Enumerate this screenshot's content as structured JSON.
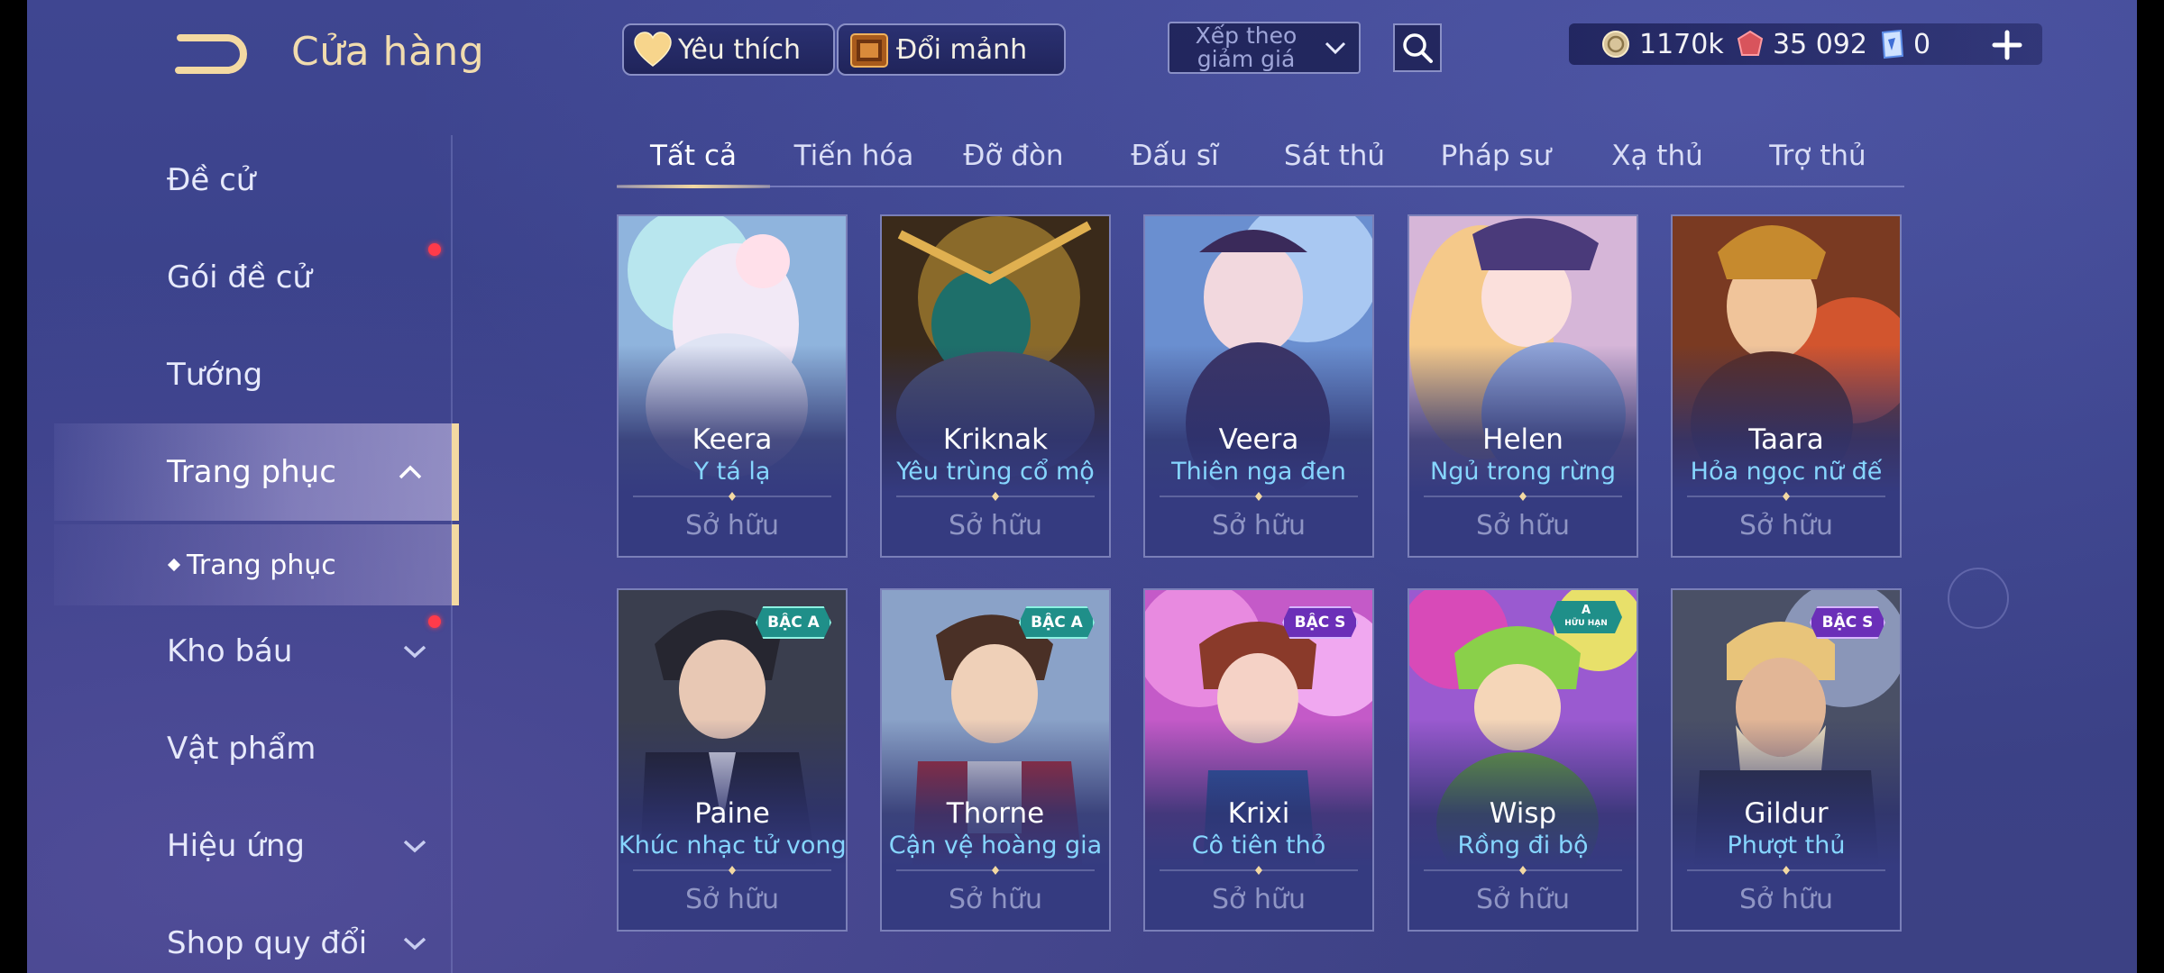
{
  "header": {
    "title": "Cửa hàng",
    "favorite_label": "Yêu thích",
    "exchange_label": "Đổi mảnh",
    "sort_label": "Xếp theo giảm giá",
    "currencies": {
      "gold": "1170k",
      "ruby": "35 092",
      "voucher": "0"
    }
  },
  "sidebar": {
    "items": [
      {
        "label": "Đề cử"
      },
      {
        "label": "Gói đề cử"
      },
      {
        "label": "Tướng"
      },
      {
        "label": "Trang phục"
      },
      {
        "label": "Trang phục"
      },
      {
        "label": "Kho báu"
      },
      {
        "label": "Vật phẩm"
      },
      {
        "label": "Hiệu ứng"
      },
      {
        "label": "Shop quy đổi"
      }
    ]
  },
  "tabs": [
    {
      "label": "Tất cả"
    },
    {
      "label": "Tiến hóa"
    },
    {
      "label": "Đỡ đòn"
    },
    {
      "label": "Đấu sĩ"
    },
    {
      "label": "Sát thủ"
    },
    {
      "label": "Pháp sư"
    },
    {
      "label": "Xạ thủ"
    },
    {
      "label": "Trợ thủ"
    }
  ],
  "cards": [
    {
      "hero": "Keera",
      "skin": "Y tá lạ",
      "status": "Sở hữu"
    },
    {
      "hero": "Kriknak",
      "skin": "Yêu trùng cổ mộ",
      "status": "Sở hữu"
    },
    {
      "hero": "Veera",
      "skin": "Thiên nga đen",
      "status": "Sở hữu"
    },
    {
      "hero": "Helen",
      "skin": "Ngủ trong rừng",
      "status": "Sở hữu"
    },
    {
      "hero": "Taara",
      "skin": "Hỏa ngọc nữ đế",
      "status": "Sở hữu"
    },
    {
      "hero": "Paine",
      "skin": "Khúc nhạc tử vong",
      "status": "Sở hữu",
      "badge": "BẬC A"
    },
    {
      "hero": "Thorne",
      "skin": "Cận vệ hoàng gia",
      "status": "Sở hữu",
      "badge": "BẬC A"
    },
    {
      "hero": "Krixi",
      "skin": "Cô tiên thỏ",
      "status": "Sở hữu",
      "badge": "BẬC S"
    },
    {
      "hero": "Wisp",
      "skin": "Rồng đi bộ",
      "status": "Sở hữu",
      "badge": "A",
      "badge_sub": "HỮU HẠN"
    },
    {
      "hero": "Gildur",
      "skin": "Phượt thủ",
      "status": "Sở hữu",
      "badge": "BẬC S"
    }
  ],
  "colors": {
    "accent_gold": "#f3d9a2",
    "skin_name": "#86d6ff",
    "notification": "#ff3b4a"
  }
}
